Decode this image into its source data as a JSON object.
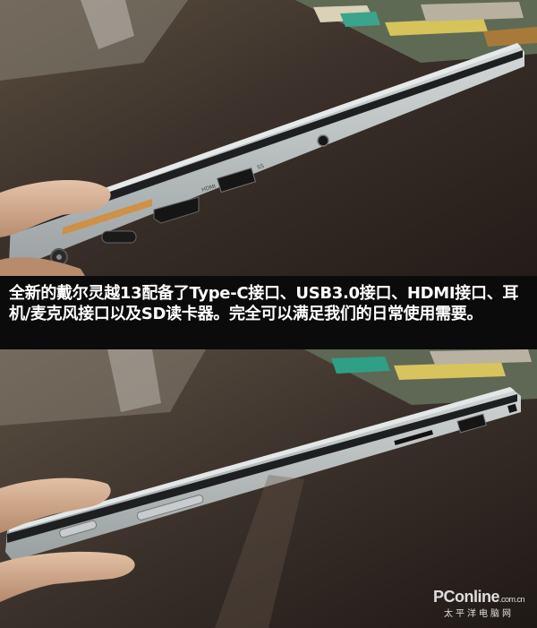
{
  "caption": "全新的戴尔灵越13配备了Type-C接口、USB3.0接口、HDMI接口、耳机/麦克风接口以及SD读卡器。完全可以满足我们的日常使用需要。",
  "watermark": {
    "logo": "PConline",
    "domain": ".com.cn",
    "subtitle": "太平洋电脑网"
  },
  "photos": [
    {
      "view": "left-side-ports",
      "port_labels": [
        "HDMI",
        "SS"
      ]
    },
    {
      "view": "right-side-ports"
    }
  ],
  "colors": {
    "caption_bg": "#0b0b0b",
    "caption_text": "#ffffff",
    "laptop_silver": "#b7bcbd",
    "bezel_dark": "#1d1f20"
  }
}
